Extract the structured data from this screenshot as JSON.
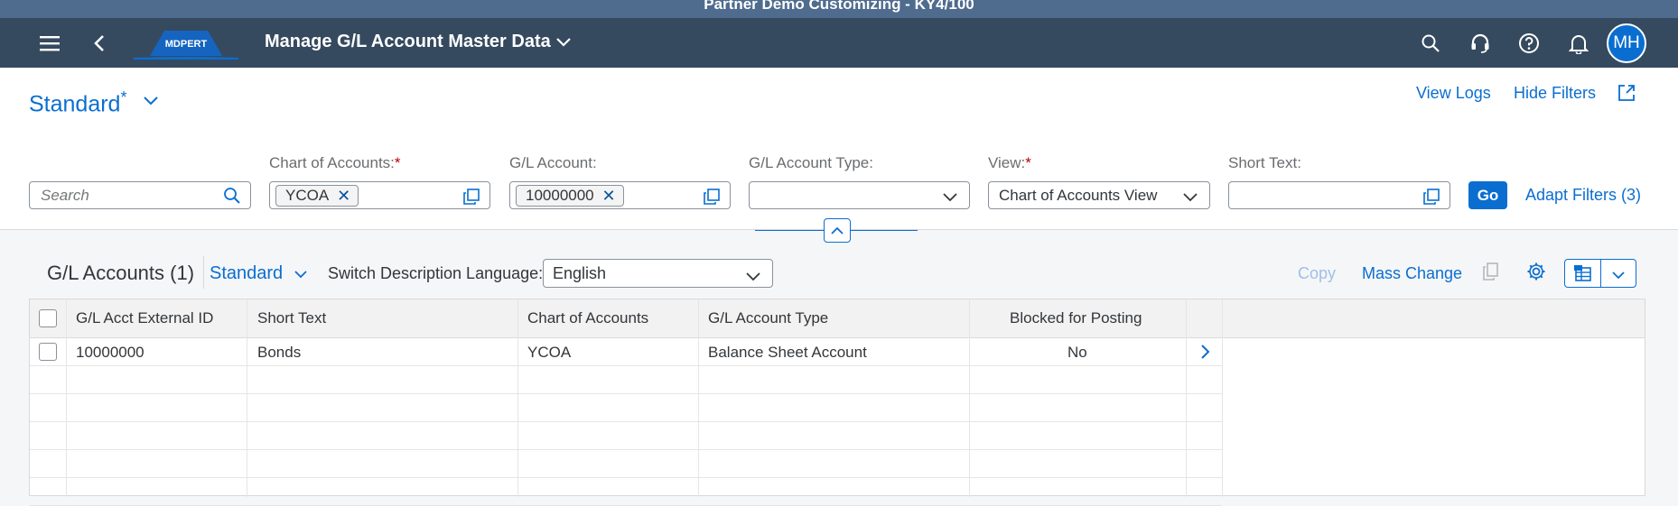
{
  "system_bar": {
    "text": "Partner Demo Customizing - KY4/100"
  },
  "shell": {
    "app_title": "Manage G/L Account Master Data",
    "logo_text": "MDPERT",
    "user_initials": "MH",
    "icons": [
      "menu-icon",
      "back-icon",
      "search-icon",
      "headset-icon",
      "help-icon",
      "bell-icon"
    ]
  },
  "header": {
    "variant": "Standard",
    "variant_modified": "*",
    "view_logs": "View Logs",
    "hide_filters": "Hide Filters"
  },
  "filters": {
    "search_placeholder": "Search",
    "chart_of_accounts": {
      "label": "Chart of Accounts:",
      "required": "*",
      "token": "YCOA"
    },
    "gl_account": {
      "label": "G/L Account:",
      "token": "10000000"
    },
    "gl_account_type": {
      "label": "G/L Account Type:",
      "value": ""
    },
    "view": {
      "label": "View:",
      "required": "*",
      "value": "Chart of Accounts View"
    },
    "short_text": {
      "label": "Short Text:",
      "value": ""
    },
    "go": "Go",
    "adapt_filters": "Adapt Filters (3)"
  },
  "table_toolbar": {
    "title": "G/L Accounts (1)",
    "variant": "Standard",
    "lang_label": "Switch Description Language:",
    "lang_value": "English",
    "copy": "Copy",
    "mass_change": "Mass Change"
  },
  "table": {
    "columns": [
      "G/L Acct External ID",
      "Short Text",
      "Chart of Accounts",
      "G/L Account Type",
      "Blocked for Posting"
    ],
    "rows": [
      [
        "10000000",
        "Bonds",
        "YCOA",
        "Balance Sheet Account",
        "No"
      ]
    ]
  },
  "colors": {
    "shell": "#354a5f",
    "accent": "#0a6ed1",
    "required": "#bb0000"
  }
}
